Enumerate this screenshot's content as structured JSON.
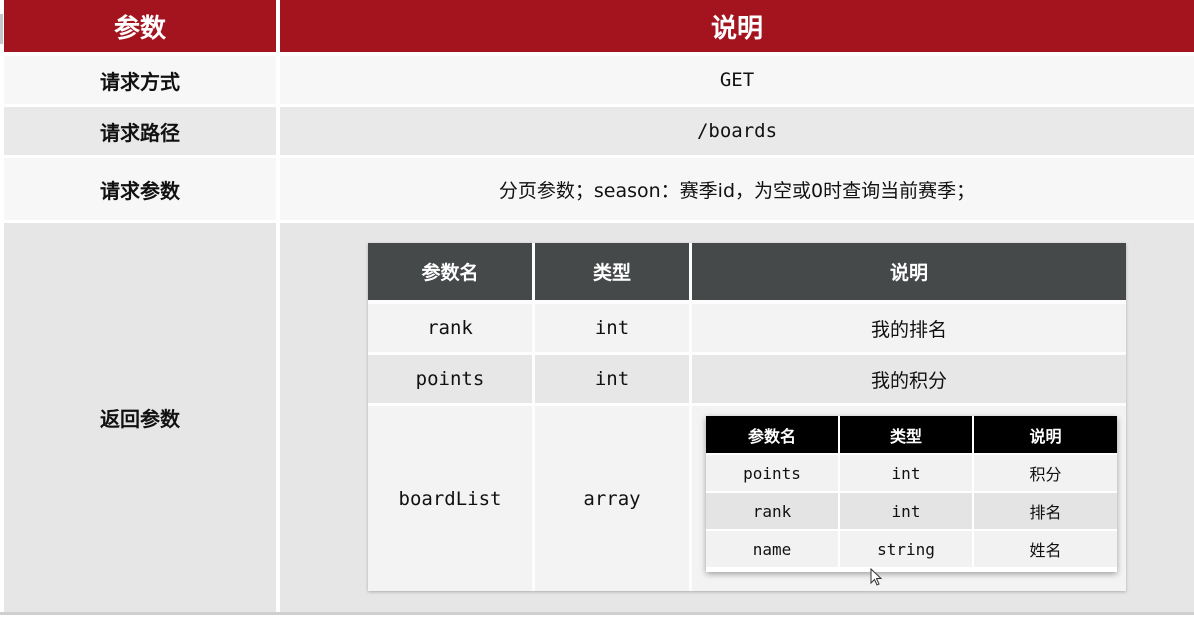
{
  "header": {
    "col1": "参数",
    "col2": "说明"
  },
  "rows": {
    "method": {
      "label": "请求方式",
      "value": "GET"
    },
    "path": {
      "label": "请求路径",
      "value": "/boards"
    },
    "params": {
      "label": "请求参数",
      "value": "分页参数；season：赛季id，为空或0时查询当前赛季；"
    },
    "response": {
      "label": "返回参数"
    }
  },
  "response_table": {
    "headers": [
      "参数名",
      "类型",
      "说明"
    ],
    "rows": [
      [
        "rank",
        "int",
        "我的排名"
      ],
      [
        "points",
        "int",
        "我的积分"
      ],
      [
        "boardList",
        "array",
        ""
      ]
    ]
  },
  "board_list_table": {
    "headers": [
      "参数名",
      "类型",
      "说明"
    ],
    "rows": [
      [
        "points",
        "int",
        "积分"
      ],
      [
        "rank",
        "int",
        "排名"
      ],
      [
        "name",
        "string",
        "姓名"
      ]
    ]
  },
  "icons": {
    "cursor": "mouse-pointer-icon"
  }
}
